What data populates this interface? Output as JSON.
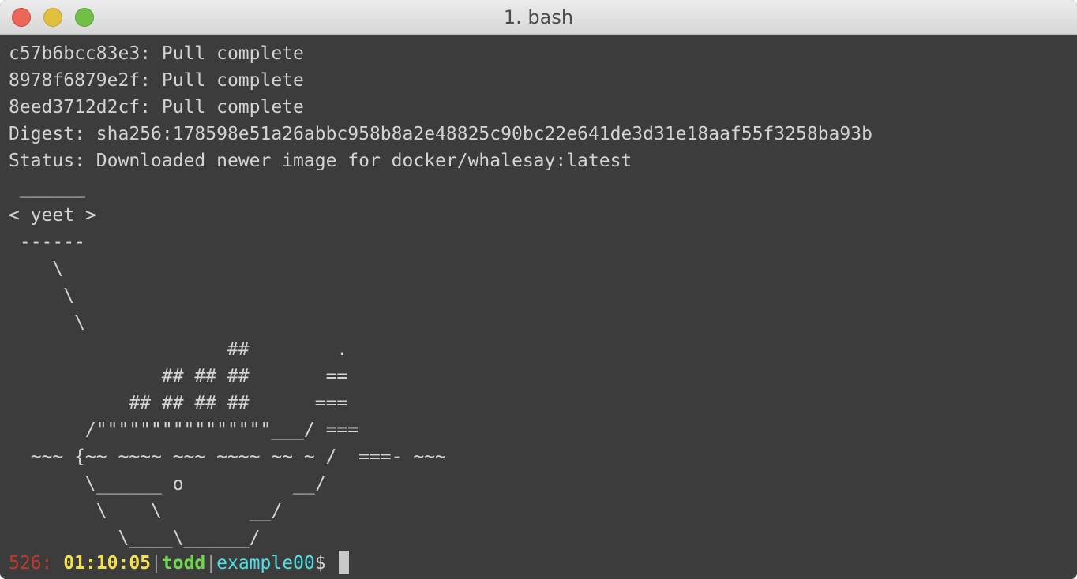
{
  "window": {
    "title": "1. bash"
  },
  "terminal": {
    "output_lines": [
      "c57b6bcc83e3: Pull complete",
      "8978f6879e2f: Pull complete",
      "8eed3712d2cf: Pull complete",
      "Digest: sha256:178598e51a26abbc958b8a2e48825c90bc22e641de3d31e18aaf55f3258ba93b",
      "Status: Downloaded newer image for docker/whalesay:latest",
      " ______",
      "< yeet >",
      " ------",
      "    \\",
      "     \\",
      "      \\",
      "                    ##        .",
      "              ## ## ##       ==",
      "           ## ## ## ##      ===",
      "       /\"\"\"\"\"\"\"\"\"\"\"\"\"\"\"\"___/ ===",
      "  ~~~ {~~ ~~~~ ~~~ ~~~~ ~~ ~ /  ===- ~~~",
      "       \\______ o          __/",
      "        \\    \\        __/",
      "          \\____\\______/"
    ],
    "prompt": {
      "history_number": "526:",
      "time": "01:10:05",
      "separator": "|",
      "user": "todd",
      "host": "example00",
      "dollar": "$"
    }
  },
  "colors": {
    "background": "#3c3c3c",
    "foreground": "#d3d3d3",
    "history_number": "#c0392b",
    "time": "#f4e04d",
    "user": "#6fd64e",
    "host": "#4fe0e6"
  }
}
